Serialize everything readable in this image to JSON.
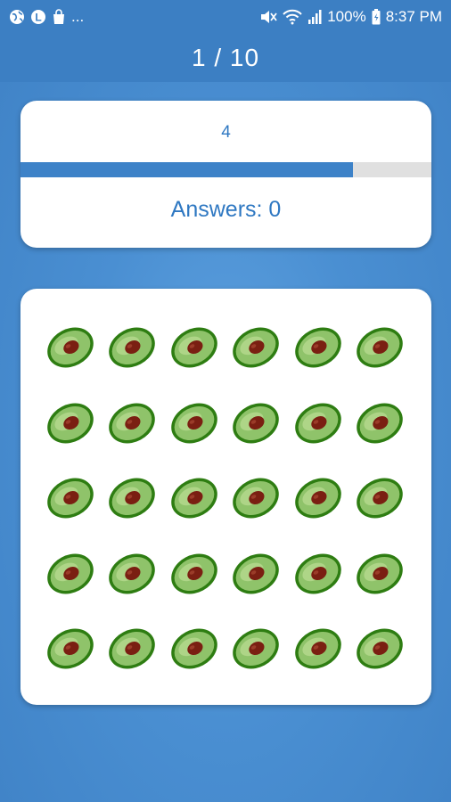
{
  "status_bar": {
    "left_icons": [
      "globe-icon",
      "l-badge-icon",
      "bag-icon"
    ],
    "more": "...",
    "battery": "100%",
    "time": "8:37 PM",
    "right_icons": [
      "mute-icon",
      "wifi-icon",
      "signal-icon",
      "battery-icon"
    ]
  },
  "header": {
    "title": "1 / 10"
  },
  "progress": {
    "count": "4",
    "fraction": 0.81
  },
  "answers": {
    "label": "Answers: 0"
  },
  "grid": {
    "rows": 5,
    "columns": 6,
    "item_icon": "avocado-icon",
    "colors": {
      "skin": "#2e7d12",
      "flesh": "#8fc36a",
      "flesh_light": "#b5d98f",
      "pit": "#7a1f12"
    }
  },
  "colors": {
    "accent": "#3d82c8",
    "text_blue": "#2f78c2",
    "track": "#e0e0e0"
  }
}
